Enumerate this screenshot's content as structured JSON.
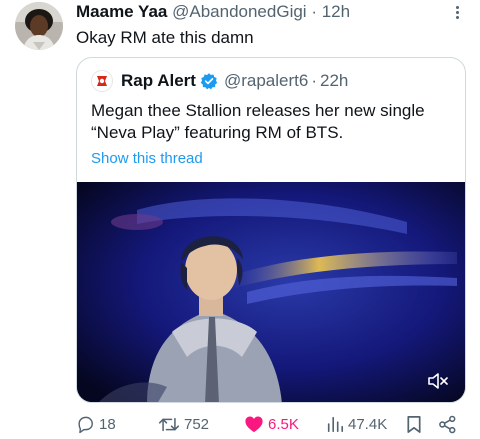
{
  "tweet": {
    "author_name": "Maame Yaa",
    "author_handle": "@AbandonedGigi",
    "separator": "·",
    "time": "12h",
    "text": "Okay RM ate this damn"
  },
  "quoted": {
    "author_name": "Rap Alert",
    "author_handle": "@rapalert6",
    "separator": "·",
    "time": "22h",
    "text": "Megan thee Stallion releases her new single “Neva Play” featuring RM of BTS.",
    "show_thread": "Show this thread"
  },
  "actions": {
    "replies": "18",
    "retweets": "752",
    "likes": "6.5K",
    "views": "47.4K"
  },
  "colors": {
    "link": "#1d9bf0",
    "like": "#f91880",
    "verified": "#1d9bf0",
    "muted_text": "#536471"
  },
  "icons": [
    "more-icon",
    "verified-badge-icon",
    "mute-icon",
    "reply-icon",
    "retweet-icon",
    "like-icon",
    "views-icon",
    "bookmark-icon",
    "share-icon"
  ]
}
